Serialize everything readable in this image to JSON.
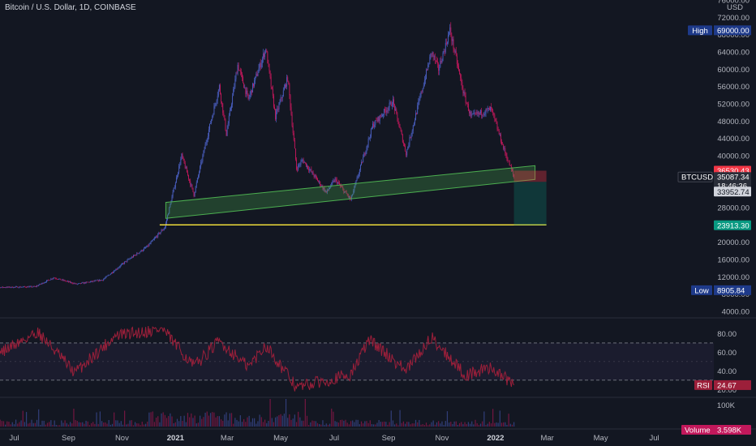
{
  "header": {
    "title": "Bitcoin / U.S. Dollar, 1D, COINBASE"
  },
  "price_axis": {
    "unit": "USD",
    "ticks": [
      "76000.00",
      "72000.00",
      "68000.00",
      "64000.00",
      "60000.00",
      "56000.00",
      "52000.00",
      "48000.00",
      "44000.00",
      "40000.00",
      "36000.00",
      "32000.00",
      "28000.00",
      "24000.00",
      "20000.00",
      "16000.00",
      "12000.00",
      "8000.00",
      "4000.00"
    ]
  },
  "tags": {
    "high_label": "High",
    "high_value": "69000.00",
    "low_label": "Low",
    "low_value": "8905.84",
    "stop_value": "36530.43",
    "symbol": "BTCUSD",
    "last_price": "35087.34",
    "countdown": "18:46:36",
    "entry_value": "33952.74",
    "target_value": "23913.30",
    "rsi_label": "RSI",
    "rsi_value": "24.67",
    "volume_label": "Volume",
    "volume_value": "3.598K"
  },
  "rsi_axis": {
    "ticks": [
      "80.00",
      "60.00",
      "40.00",
      "20.00"
    ]
  },
  "volume_axis": {
    "ticks": [
      "100K"
    ]
  },
  "time_axis": {
    "ticks": [
      "Jul",
      "Sep",
      "Nov",
      "2021",
      "Mar",
      "May",
      "Jul",
      "Sep",
      "Nov",
      "2022",
      "Mar",
      "May",
      "Jul"
    ]
  },
  "colors": {
    "up": "#4a5fc1",
    "down": "#c2185b",
    "background": "#131722",
    "channel": "#4caf50",
    "support": "#ffeb3b",
    "stop_zone": "#f23645",
    "target_zone": "#089981",
    "rsi": "#9c1f3a"
  },
  "chart_data": {
    "type": "candlestick",
    "title": "Bitcoin / U.S. Dollar, 1D, COINBASE",
    "x_range": [
      "2020-06-01",
      "2022-07-31"
    ],
    "y_range": [
      4000,
      76000
    ],
    "anchor_points": [
      {
        "date": "2020-06-01",
        "close": 9500
      },
      {
        "date": "2020-07-25",
        "close": 9700
      },
      {
        "date": "2020-08-15",
        "close": 11800
      },
      {
        "date": "2020-09-10",
        "close": 10300
      },
      {
        "date": "2020-10-10",
        "close": 11300
      },
      {
        "date": "2020-11-05",
        "close": 15500
      },
      {
        "date": "2020-11-30",
        "close": 19000
      },
      {
        "date": "2020-12-20",
        "close": 23500
      },
      {
        "date": "2021-01-08",
        "close": 40000
      },
      {
        "date": "2021-01-22",
        "close": 31000
      },
      {
        "date": "2021-02-08",
        "close": 46000
      },
      {
        "date": "2021-02-20",
        "close": 56000
      },
      {
        "date": "2021-02-28",
        "close": 45000
      },
      {
        "date": "2021-03-13",
        "close": 61000
      },
      {
        "date": "2021-03-25",
        "close": 53000
      },
      {
        "date": "2021-04-14",
        "close": 64800
      },
      {
        "date": "2021-04-25",
        "close": 49000
      },
      {
        "date": "2021-05-09",
        "close": 58000
      },
      {
        "date": "2021-05-19",
        "close": 37000
      },
      {
        "date": "2021-05-26",
        "close": 39000
      },
      {
        "date": "2021-06-22",
        "close": 31500
      },
      {
        "date": "2021-07-02",
        "close": 34500
      },
      {
        "date": "2021-07-20",
        "close": 29800
      },
      {
        "date": "2021-08-14",
        "close": 47000
      },
      {
        "date": "2021-09-06",
        "close": 52500
      },
      {
        "date": "2021-09-21",
        "close": 40500
      },
      {
        "date": "2021-10-20",
        "close": 64000
      },
      {
        "date": "2021-10-28",
        "close": 60000
      },
      {
        "date": "2021-11-10",
        "close": 69000
      },
      {
        "date": "2021-11-26",
        "close": 54000
      },
      {
        "date": "2021-12-04",
        "close": 49000
      },
      {
        "date": "2021-12-27",
        "close": 50800
      },
      {
        "date": "2022-01-10",
        "close": 41800
      },
      {
        "date": "2022-01-22",
        "close": 35087
      }
    ],
    "channel": {
      "lower_start": {
        "date": "2020-12-21",
        "price": 25500
      },
      "lower_end": {
        "date": "2022-02-15",
        "price": 34500
      },
      "upper_start": {
        "date": "2020-12-21",
        "price": 29200
      },
      "upper_end": {
        "date": "2022-02-15",
        "price": 37700
      }
    },
    "support_line": {
      "price": 24000,
      "from": "2020-12-14",
      "to": "2022-02-28"
    },
    "position": {
      "start": "2022-01-22",
      "end": "2022-02-28",
      "stop": 36530.43,
      "entry": 33952.74,
      "target": 23913.3
    },
    "rsi": {
      "range": [
        15,
        90
      ],
      "levels": [
        70,
        30
      ],
      "anchor_points": [
        {
          "date": "2020-06-01",
          "v": 52
        },
        {
          "date": "2020-07-28",
          "v": 82
        },
        {
          "date": "2020-09-08",
          "v": 38
        },
        {
          "date": "2020-10-25",
          "v": 78
        },
        {
          "date": "2020-12-17",
          "v": 85
        },
        {
          "date": "2021-01-22",
          "v": 45
        },
        {
          "date": "2021-02-20",
          "v": 72
        },
        {
          "date": "2021-03-25",
          "v": 44
        },
        {
          "date": "2021-04-14",
          "v": 68
        },
        {
          "date": "2021-05-19",
          "v": 22
        },
        {
          "date": "2021-06-22",
          "v": 30
        },
        {
          "date": "2021-07-20",
          "v": 36
        },
        {
          "date": "2021-08-10",
          "v": 74
        },
        {
          "date": "2021-09-21",
          "v": 40
        },
        {
          "date": "2021-10-20",
          "v": 76
        },
        {
          "date": "2021-11-28",
          "v": 35
        },
        {
          "date": "2021-12-27",
          "v": 44
        },
        {
          "date": "2022-01-22",
          "v": 24.67
        }
      ]
    },
    "volume": {
      "max": 100000,
      "last": 3598
    }
  }
}
